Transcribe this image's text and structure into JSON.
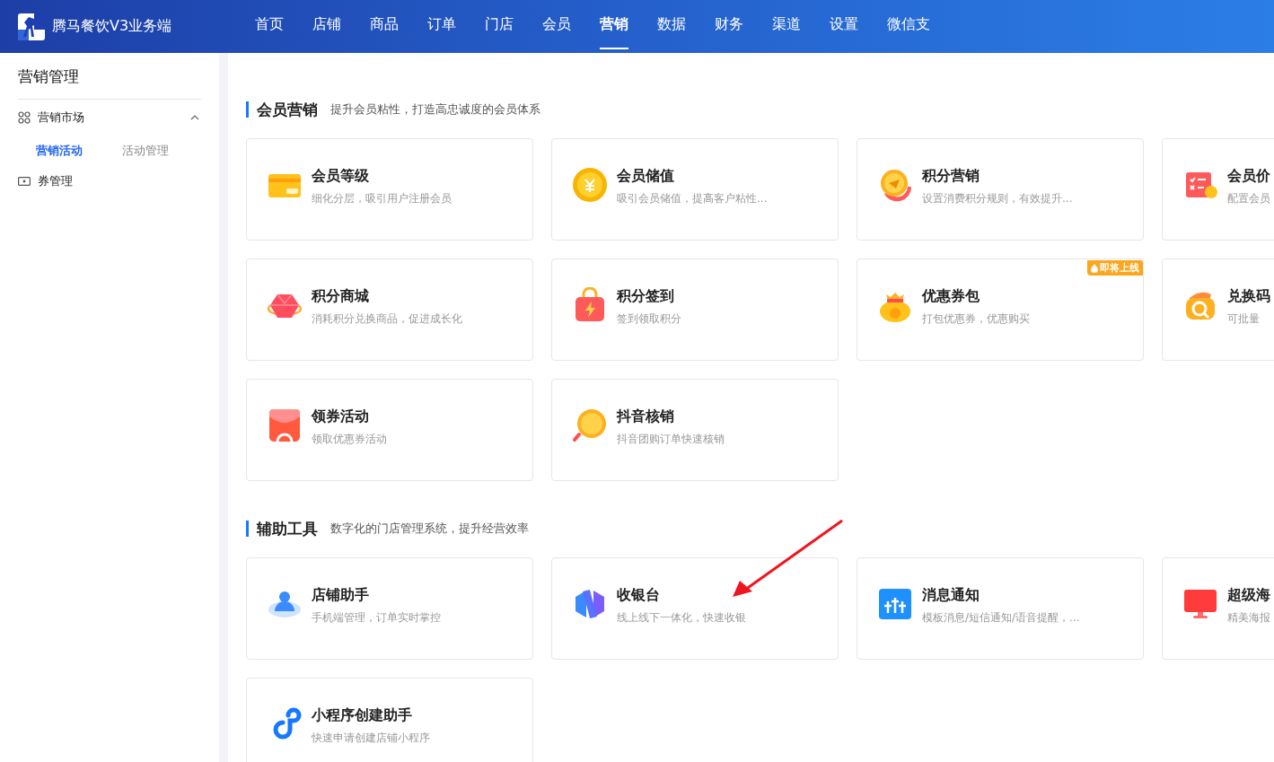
{
  "app": {
    "title": "腾马餐饮V3业务端"
  },
  "nav": [
    {
      "label": "首页",
      "selected": false
    },
    {
      "label": "店铺",
      "selected": false
    },
    {
      "label": "商品",
      "selected": false
    },
    {
      "label": "订单",
      "selected": false
    },
    {
      "label": "门店",
      "selected": false
    },
    {
      "label": "会员",
      "selected": false
    },
    {
      "label": "营销",
      "selected": true
    },
    {
      "label": "数据",
      "selected": false
    },
    {
      "label": "财务",
      "selected": false
    },
    {
      "label": "渠道",
      "selected": false
    },
    {
      "label": "设置",
      "selected": false
    },
    {
      "label": "微信支",
      "selected": false
    }
  ],
  "sidebar": {
    "title": "营销管理",
    "items": [
      {
        "label": "营销市场",
        "expanded": true,
        "children": [
          {
            "label": "营销活动",
            "selected": true
          },
          {
            "label": "活动管理",
            "selected": false
          }
        ]
      },
      {
        "label": "券管理"
      }
    ]
  },
  "sections": [
    {
      "title": "会员营销",
      "subtitle": "提升会员粘性，打造高忠诚度的会员体系",
      "cards": [
        {
          "title": "会员等级",
          "desc": "细化分层，吸引用户注册会员"
        },
        {
          "title": "会员储值",
          "desc": "吸引会员储值，提高客户粘性..."
        },
        {
          "title": "积分营销",
          "desc": "设置消费积分规则，有效提升..."
        },
        {
          "title": "会员价",
          "desc": "配置会员"
        },
        {
          "title": "积分商城",
          "desc": "消耗积分兑换商品，促进成长化"
        },
        {
          "title": "积分签到",
          "desc": "签到领取积分"
        },
        {
          "title": "优惠券包",
          "desc": "打包优惠券，优惠购买",
          "badge": "即将上线"
        },
        {
          "title": "兑换码",
          "desc": "可批量"
        },
        {
          "title": "领券活动",
          "desc": "领取优惠券活动"
        },
        {
          "title": "抖音核销",
          "desc": "抖音团购订单快速核销"
        }
      ]
    },
    {
      "title": "辅助工具",
      "subtitle": "数字化的门店管理系统，提升经营效率",
      "cards": [
        {
          "title": "店铺助手",
          "desc": "手机端管理，订单实时掌控"
        },
        {
          "title": "收银台",
          "desc": "线上线下一体化，快速收银"
        },
        {
          "title": "消息通知",
          "desc": "模板消息/短信通知/语音提醒，..."
        },
        {
          "title": "超级海",
          "desc": "精美海报"
        },
        {
          "title": "小程序创建助手",
          "desc": "快速申请创建店铺小程序"
        }
      ]
    }
  ],
  "annotation": {
    "kind": "arrow"
  }
}
